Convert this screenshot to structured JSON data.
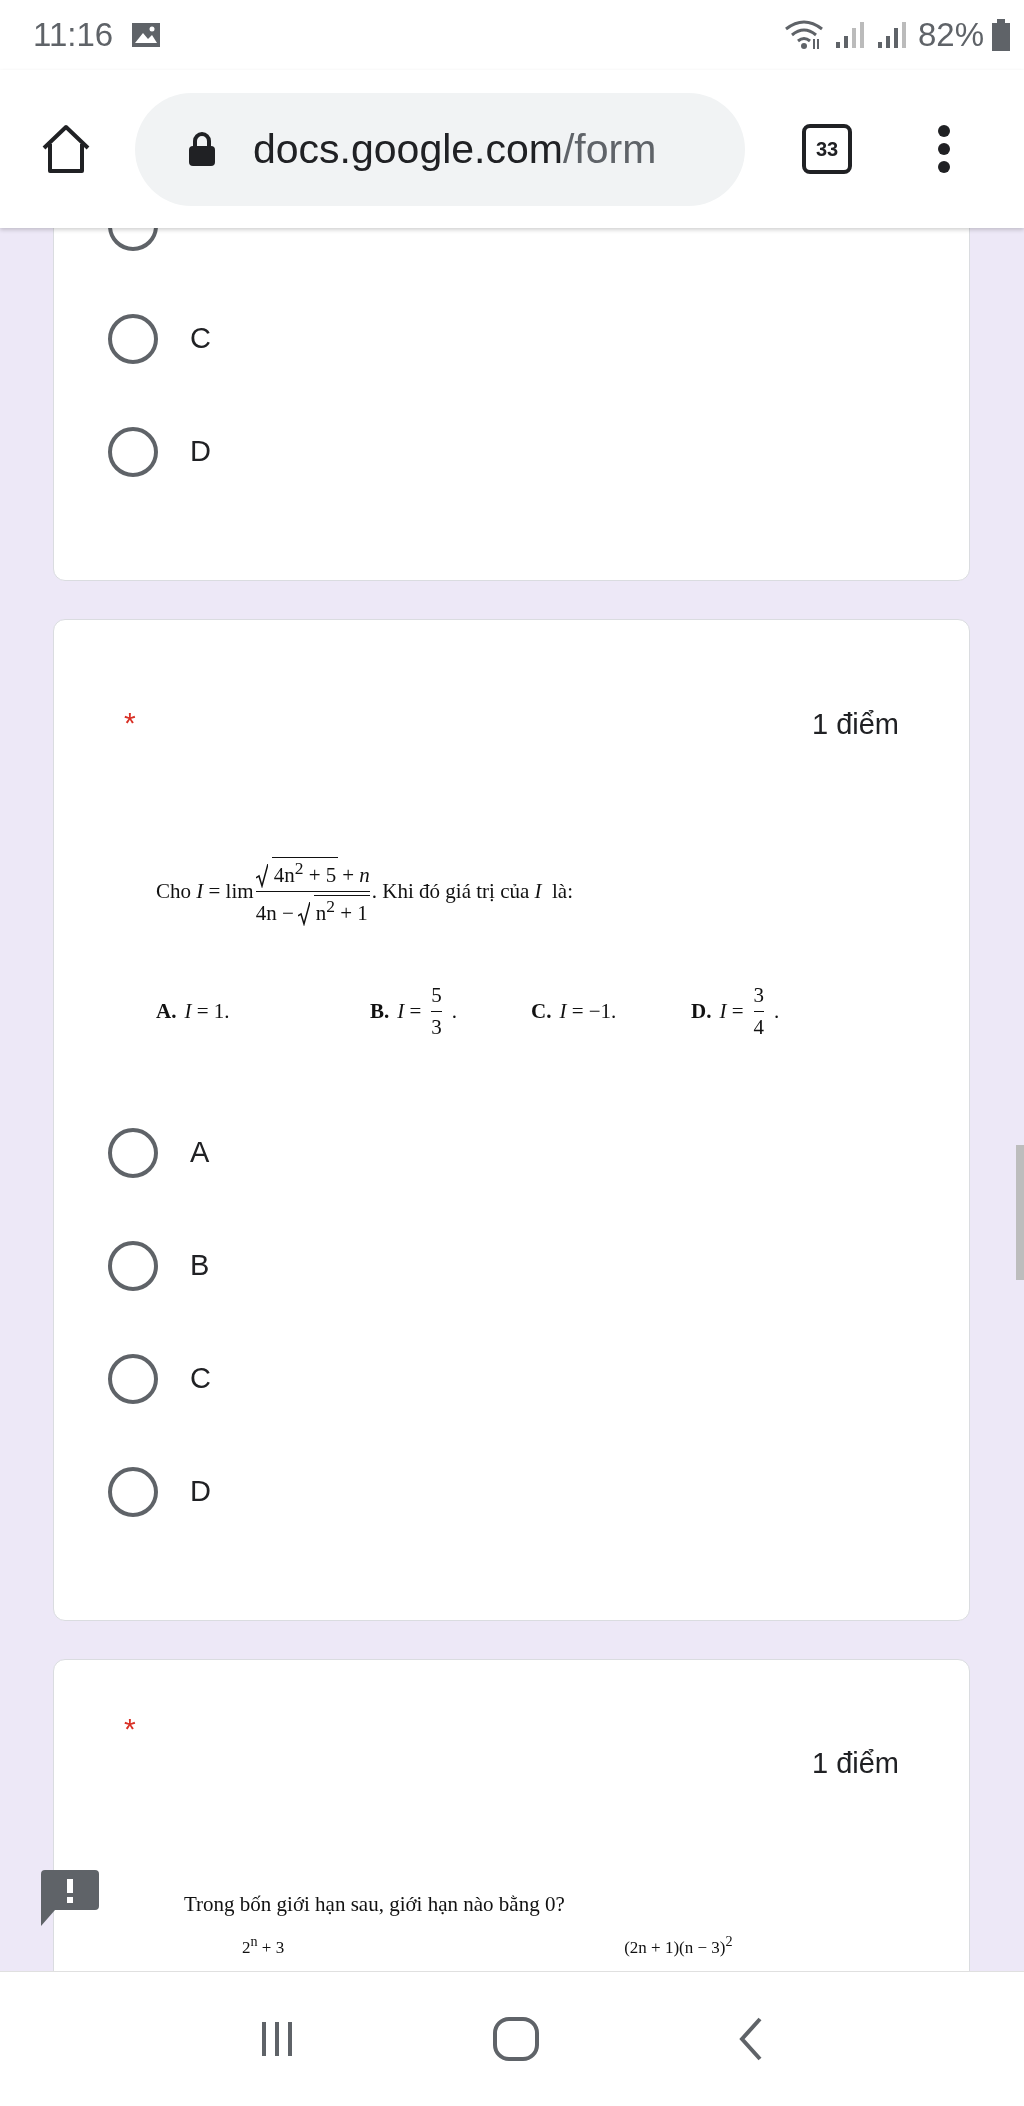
{
  "status_bar": {
    "time": "11:16",
    "battery": "82%"
  },
  "browser": {
    "url_host": "docs.google.com",
    "url_path": "/form",
    "tab_count": "33"
  },
  "questions": [
    {
      "options": [
        {
          "selected": false
        },
        {
          "label": "C",
          "selected": false
        },
        {
          "label": "D",
          "selected": false
        }
      ]
    },
    {
      "required_mark": "*",
      "points": "1 điểm",
      "stem": [
        {
          "kind": "text",
          "text": "Cho *I* = lim"
        },
        {
          "kind": "fraction",
          "numerator": [
            {
              "kind": "sqrt",
              "text": "4n$^{2}$ + 5"
            },
            {
              "kind": "text",
              "text": "+ *n*"
            }
          ],
          "denominator": [
            {
              "kind": "text",
              "text": "4n −"
            },
            {
              "kind": "sqrt",
              "text": "n$^{2}$ + 1"
            }
          ]
        },
        {
          "kind": "text",
          "text": ". Khi đó giá trị của *I*  là:"
        }
      ],
      "choices": [
        {
          "letter": "A.",
          "kind": "plain",
          "expr": "*I* = 1."
        },
        {
          "letter": "B.",
          "kind": "fraction",
          "expr": "*I* =",
          "numerator": "5",
          "denominator": "3",
          "tail": "."
        },
        {
          "letter": "C.",
          "kind": "plain",
          "expr": "*I* = −1."
        },
        {
          "letter": "D.",
          "kind": "fraction",
          "expr": "*I* =",
          "numerator": "3",
          "denominator": "4",
          "tail": "."
        }
      ],
      "options": [
        {
          "label": "A",
          "selected": false
        },
        {
          "label": "B",
          "selected": false
        },
        {
          "label": "C",
          "selected": false
        },
        {
          "label": "D",
          "selected": false
        }
      ]
    },
    {
      "required_mark": "*",
      "points": "1 điểm",
      "feedback_flag": true,
      "prompt": "Trong bốn giới hạn sau, giới hạn nào bằng 0?",
      "partial_formulas": [
        "2$^{n}$ + 3",
        "(2n + 1)(n − 3)$^{2}$"
      ]
    }
  ]
}
